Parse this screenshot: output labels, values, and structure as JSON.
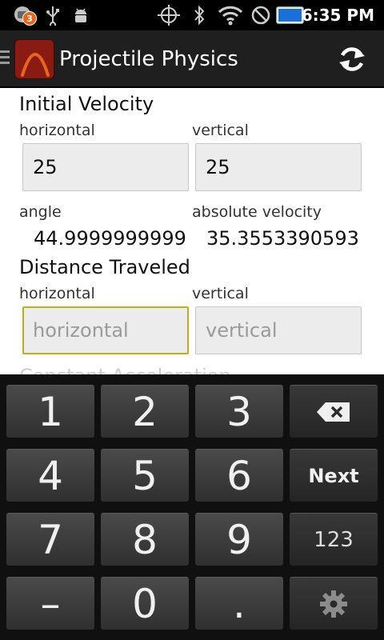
{
  "status_bar": {
    "notification_count": "3",
    "time": "6:35 PM",
    "icons": [
      "notification-icon",
      "usb-icon",
      "android-debug-icon",
      "gps-icon",
      "bluetooth-icon",
      "wifi-icon",
      "do-not-disturb-icon",
      "battery-icon"
    ]
  },
  "action_bar": {
    "title": "Projectile Physics",
    "icons": [
      "menu-lines-icon",
      "app-parabola-icon",
      "refresh-icon"
    ]
  },
  "initial_velocity": {
    "heading": "Initial Velocity",
    "horizontal_label": "horizontal",
    "horizontal_value": "25",
    "vertical_label": "vertical",
    "vertical_value": "25",
    "angle_label": "angle",
    "angle_value": "44.9999999999",
    "absolute_label": "absolute velocity",
    "absolute_value": "35.3553390593"
  },
  "distance_traveled": {
    "heading": "Distance Traveled",
    "horizontal_label": "horizontal",
    "horizontal_placeholder": "horizontal",
    "vertical_label": "vertical",
    "vertical_placeholder": "vertical"
  },
  "next_section_heading": "Constant Acceleration",
  "keyboard": {
    "keys": [
      "1",
      "2",
      "3",
      "4",
      "5",
      "6",
      "7",
      "8",
      "9",
      "–",
      "0",
      "."
    ],
    "next": "Next",
    "mode": "123",
    "icons": [
      "backspace-icon",
      "settings-gear-icon"
    ]
  },
  "colors": {
    "focus_border": "#b9b11b",
    "app_icon_bg": "#8a1b12",
    "app_icon_curve": "#e8661b"
  }
}
